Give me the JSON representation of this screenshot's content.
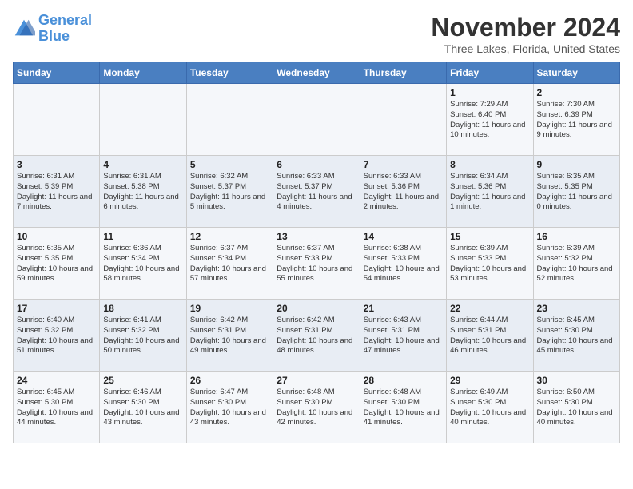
{
  "logo": {
    "line1": "General",
    "line2": "Blue"
  },
  "title": "November 2024",
  "location": "Three Lakes, Florida, United States",
  "days_of_week": [
    "Sunday",
    "Monday",
    "Tuesday",
    "Wednesday",
    "Thursday",
    "Friday",
    "Saturday"
  ],
  "weeks": [
    [
      {
        "day": "",
        "text": ""
      },
      {
        "day": "",
        "text": ""
      },
      {
        "day": "",
        "text": ""
      },
      {
        "day": "",
        "text": ""
      },
      {
        "day": "",
        "text": ""
      },
      {
        "day": "1",
        "text": "Sunrise: 7:29 AM\nSunset: 6:40 PM\nDaylight: 11 hours and 10 minutes."
      },
      {
        "day": "2",
        "text": "Sunrise: 7:30 AM\nSunset: 6:39 PM\nDaylight: 11 hours and 9 minutes."
      }
    ],
    [
      {
        "day": "3",
        "text": "Sunrise: 6:31 AM\nSunset: 5:39 PM\nDaylight: 11 hours and 7 minutes."
      },
      {
        "day": "4",
        "text": "Sunrise: 6:31 AM\nSunset: 5:38 PM\nDaylight: 11 hours and 6 minutes."
      },
      {
        "day": "5",
        "text": "Sunrise: 6:32 AM\nSunset: 5:37 PM\nDaylight: 11 hours and 5 minutes."
      },
      {
        "day": "6",
        "text": "Sunrise: 6:33 AM\nSunset: 5:37 PM\nDaylight: 11 hours and 4 minutes."
      },
      {
        "day": "7",
        "text": "Sunrise: 6:33 AM\nSunset: 5:36 PM\nDaylight: 11 hours and 2 minutes."
      },
      {
        "day": "8",
        "text": "Sunrise: 6:34 AM\nSunset: 5:36 PM\nDaylight: 11 hours and 1 minute."
      },
      {
        "day": "9",
        "text": "Sunrise: 6:35 AM\nSunset: 5:35 PM\nDaylight: 11 hours and 0 minutes."
      }
    ],
    [
      {
        "day": "10",
        "text": "Sunrise: 6:35 AM\nSunset: 5:35 PM\nDaylight: 10 hours and 59 minutes."
      },
      {
        "day": "11",
        "text": "Sunrise: 6:36 AM\nSunset: 5:34 PM\nDaylight: 10 hours and 58 minutes."
      },
      {
        "day": "12",
        "text": "Sunrise: 6:37 AM\nSunset: 5:34 PM\nDaylight: 10 hours and 57 minutes."
      },
      {
        "day": "13",
        "text": "Sunrise: 6:37 AM\nSunset: 5:33 PM\nDaylight: 10 hours and 55 minutes."
      },
      {
        "day": "14",
        "text": "Sunrise: 6:38 AM\nSunset: 5:33 PM\nDaylight: 10 hours and 54 minutes."
      },
      {
        "day": "15",
        "text": "Sunrise: 6:39 AM\nSunset: 5:33 PM\nDaylight: 10 hours and 53 minutes."
      },
      {
        "day": "16",
        "text": "Sunrise: 6:39 AM\nSunset: 5:32 PM\nDaylight: 10 hours and 52 minutes."
      }
    ],
    [
      {
        "day": "17",
        "text": "Sunrise: 6:40 AM\nSunset: 5:32 PM\nDaylight: 10 hours and 51 minutes."
      },
      {
        "day": "18",
        "text": "Sunrise: 6:41 AM\nSunset: 5:32 PM\nDaylight: 10 hours and 50 minutes."
      },
      {
        "day": "19",
        "text": "Sunrise: 6:42 AM\nSunset: 5:31 PM\nDaylight: 10 hours and 49 minutes."
      },
      {
        "day": "20",
        "text": "Sunrise: 6:42 AM\nSunset: 5:31 PM\nDaylight: 10 hours and 48 minutes."
      },
      {
        "day": "21",
        "text": "Sunrise: 6:43 AM\nSunset: 5:31 PM\nDaylight: 10 hours and 47 minutes."
      },
      {
        "day": "22",
        "text": "Sunrise: 6:44 AM\nSunset: 5:31 PM\nDaylight: 10 hours and 46 minutes."
      },
      {
        "day": "23",
        "text": "Sunrise: 6:45 AM\nSunset: 5:30 PM\nDaylight: 10 hours and 45 minutes."
      }
    ],
    [
      {
        "day": "24",
        "text": "Sunrise: 6:45 AM\nSunset: 5:30 PM\nDaylight: 10 hours and 44 minutes."
      },
      {
        "day": "25",
        "text": "Sunrise: 6:46 AM\nSunset: 5:30 PM\nDaylight: 10 hours and 43 minutes."
      },
      {
        "day": "26",
        "text": "Sunrise: 6:47 AM\nSunset: 5:30 PM\nDaylight: 10 hours and 43 minutes."
      },
      {
        "day": "27",
        "text": "Sunrise: 6:48 AM\nSunset: 5:30 PM\nDaylight: 10 hours and 42 minutes."
      },
      {
        "day": "28",
        "text": "Sunrise: 6:48 AM\nSunset: 5:30 PM\nDaylight: 10 hours and 41 minutes."
      },
      {
        "day": "29",
        "text": "Sunrise: 6:49 AM\nSunset: 5:30 PM\nDaylight: 10 hours and 40 minutes."
      },
      {
        "day": "30",
        "text": "Sunrise: 6:50 AM\nSunset: 5:30 PM\nDaylight: 10 hours and 40 minutes."
      }
    ]
  ]
}
